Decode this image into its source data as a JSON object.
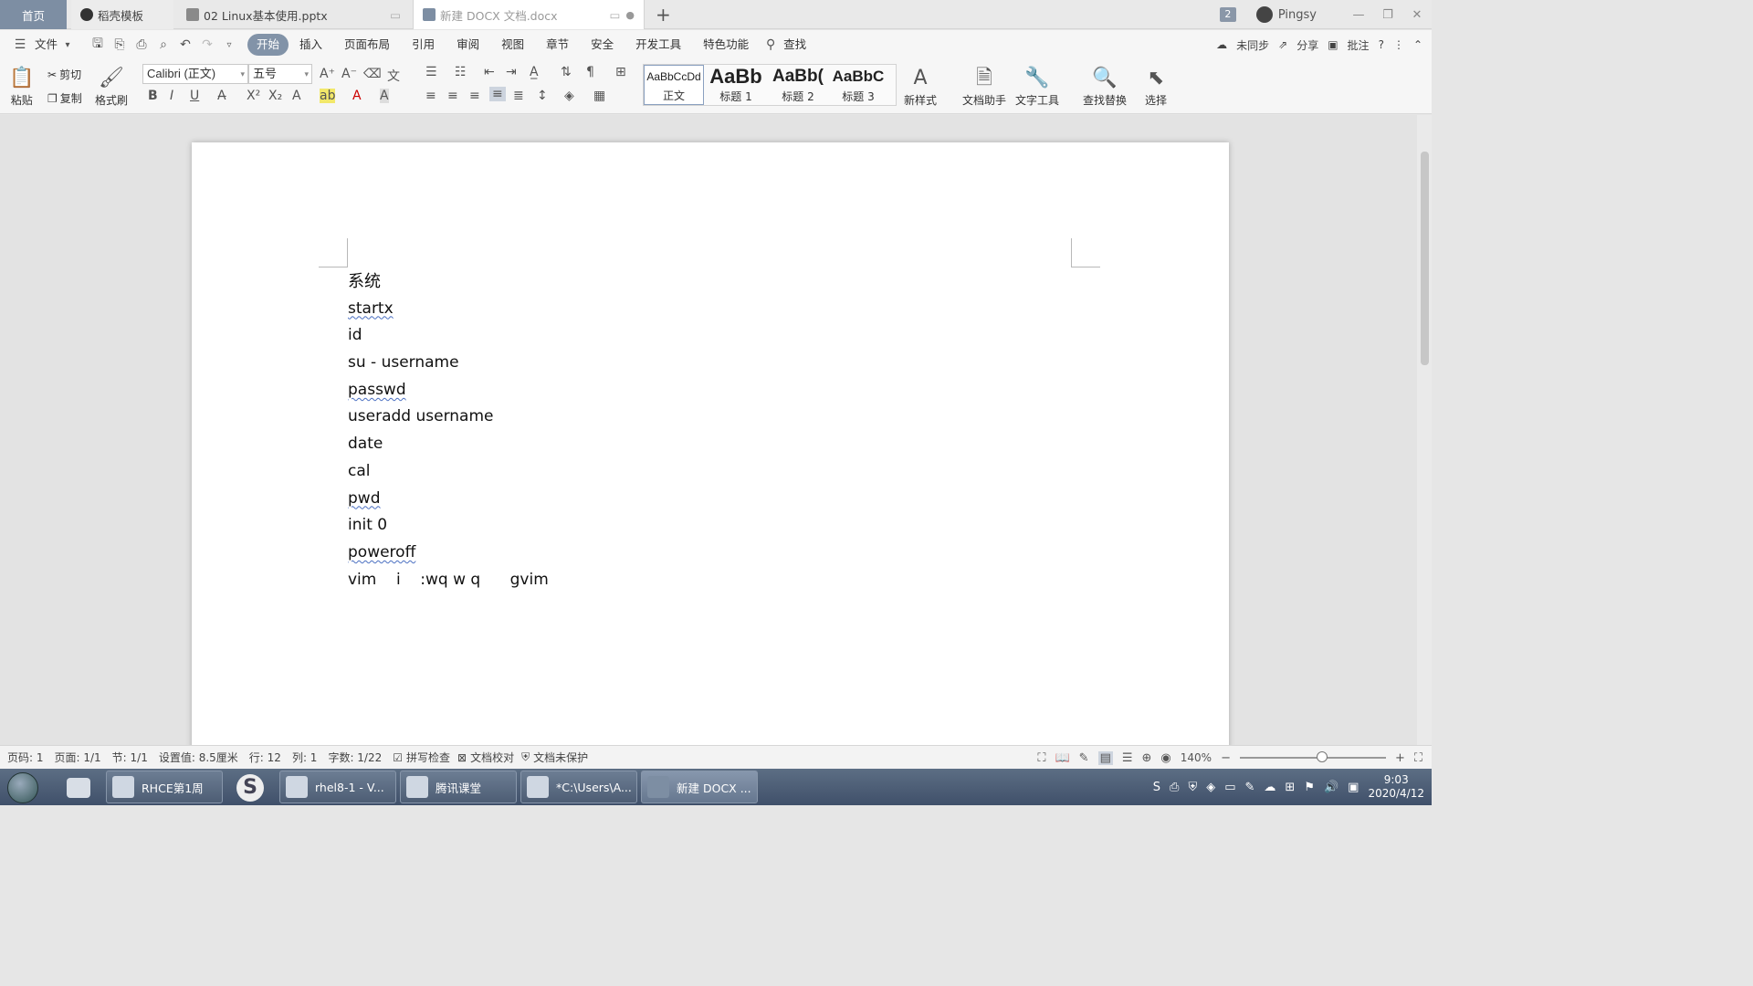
{
  "tabs": {
    "home": "首页",
    "items": [
      {
        "label": "稻壳模板"
      },
      {
        "label": "02 Linux基本使用.pptx"
      },
      {
        "label": "新建 DOCX 文档.docx"
      }
    ],
    "new_tab": "+",
    "count_badge": "2",
    "user": "Pingsy"
  },
  "menu": {
    "file": "文件",
    "items": [
      "开始",
      "插入",
      "页面布局",
      "引用",
      "审阅",
      "视图",
      "章节",
      "安全",
      "开发工具",
      "特色功能"
    ],
    "active_index": 0,
    "search": "查找",
    "right": {
      "sync": "未同步",
      "share": "分享",
      "comment": "批注"
    }
  },
  "ribbon": {
    "paste": "粘贴",
    "cut": "剪切",
    "copy": "复制",
    "format_painter": "格式刷",
    "font_name": "Calibri (正文)",
    "font_size": "五号",
    "styles": [
      {
        "preview": "AaBbCcDd",
        "label": "正文"
      },
      {
        "preview": "AaBb",
        "label": "标题 1"
      },
      {
        "preview": "AaBb(",
        "label": "标题 2"
      },
      {
        "preview": "AaBbC",
        "label": "标题 3"
      }
    ],
    "new_style": "新样式",
    "doc_assistant": "文档助手",
    "text_tools": "文字工具",
    "find_replace": "查找替换",
    "select": "选择"
  },
  "document": {
    "lines": [
      {
        "text": "系统"
      },
      {
        "text": "startx"
      },
      {
        "text": "id"
      },
      {
        "text": "su - username"
      },
      {
        "text": "passwd"
      },
      {
        "text": "useradd username"
      },
      {
        "text": "date"
      },
      {
        "text": "cal"
      },
      {
        "text": "pwd"
      },
      {
        "text": "init 0"
      },
      {
        "text": "poweroff"
      },
      {
        "text": "vim    i    :wq w q      gvim"
      }
    ]
  },
  "status": {
    "page_no": "页码: 1",
    "pages": "页面: 1/1",
    "section": "节: 1/1",
    "setting": "设置值: 8.5厘米",
    "row": "行: 12",
    "col": "列: 1",
    "words": "字数: 1/22",
    "spell": "拼写检查",
    "proof": "文档校对",
    "protect": "文档未保护",
    "zoom": "140%"
  },
  "taskbar": {
    "items": [
      {
        "label": "RHCE第1周"
      },
      {
        "label": "rhel8-1 - V..."
      },
      {
        "label": "腾讯课堂"
      },
      {
        "label": "*C:\\Users\\A..."
      },
      {
        "label": "新建 DOCX ..."
      }
    ],
    "time": "9:03",
    "date": "2020/4/12"
  },
  "colors": {
    "accent": "#8293a8",
    "home_tab": "#7d8ea3",
    "taskbar": "#4d5d74"
  }
}
